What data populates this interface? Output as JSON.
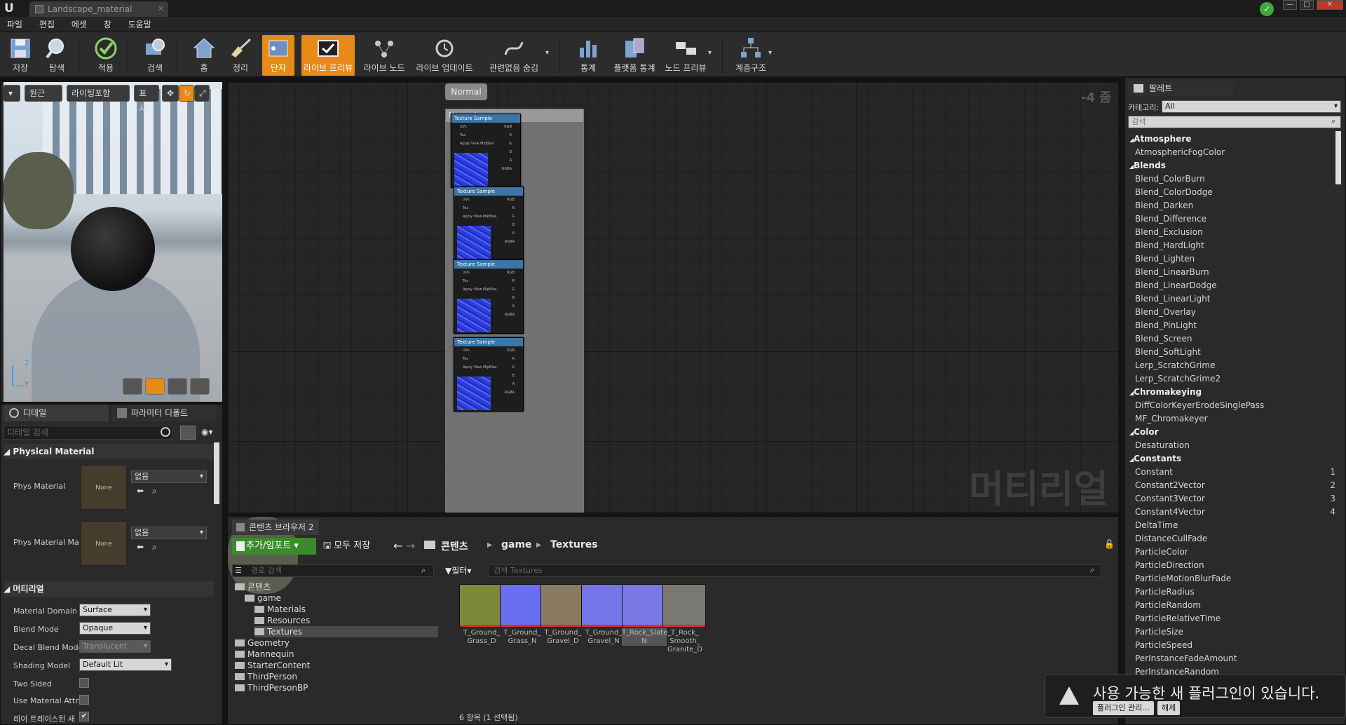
{
  "window": {
    "tab_title": "Landscape_material",
    "minimize_label": "—",
    "maximize_label": "□",
    "close_label": "✕"
  },
  "menu": [
    "파일",
    "편집",
    "에셋",
    "창",
    "도움말"
  ],
  "toolbar": {
    "items": [
      {
        "label": "저장",
        "icon": "save-icon"
      },
      {
        "label": "탐색",
        "icon": "browse-icon"
      },
      {
        "label": "적용",
        "icon": "apply-icon"
      },
      {
        "label": "검색",
        "icon": "search-icon"
      },
      {
        "label": "홈",
        "icon": "home-icon"
      },
      {
        "label": "정리",
        "icon": "clean-up-icon"
      },
      {
        "label": "단자",
        "icon": "connectors-icon",
        "active": true
      },
      {
        "label": "라이브 프리뷰",
        "icon": "live-preview-icon",
        "active": true
      },
      {
        "label": "라이브 노드",
        "icon": "live-nodes-icon"
      },
      {
        "label": "라이브 업데이트",
        "icon": "live-update-icon"
      },
      {
        "label": "관련없음 숨김",
        "icon": "hide-unrelated-icon"
      },
      {
        "label": "통계",
        "icon": "stats-icon"
      },
      {
        "label": "플랫폼 통계",
        "icon": "platform-stats-icon"
      },
      {
        "label": "노드 프리뷰",
        "icon": "node-preview-icon"
      },
      {
        "label": "계층구조",
        "icon": "hierarchy-icon"
      }
    ]
  },
  "viewport": {
    "perspective": "원근",
    "lighting": "라이팅포함",
    "show": "표시",
    "axis_z": "Z",
    "axis_y": "Y"
  },
  "details": {
    "tabs": [
      "디테일",
      "파라미터 디폴트"
    ],
    "search_placeholder": "디테일 검색",
    "physical_section": "Physical Material",
    "phys_rows": [
      {
        "label": "Phys Material",
        "thumb": "None",
        "value": "없음"
      },
      {
        "label": "Phys Material Ma",
        "thumb": "None",
        "value": "없음"
      }
    ],
    "material_section": "머티리얼",
    "props": [
      {
        "label": "Material Domain",
        "value": "Surface"
      },
      {
        "label": "Blend Mode",
        "value": "Opaque"
      },
      {
        "label": "Decal Blend Mode",
        "value": "Translucent"
      },
      {
        "label": "Shading Model",
        "value": "Default Lit"
      },
      {
        "label": "Two Sided",
        "checked": false
      },
      {
        "label": "Use Material Attri",
        "checked": false
      },
      {
        "label": "레이 트레이스된 새",
        "checked": true
      }
    ]
  },
  "graph": {
    "zoom": "-4 줌",
    "watermark": "머티리얼",
    "comment_bubble": "Normal",
    "comment_title": "Normal",
    "node_title": "Texture Sample",
    "pins": [
      {
        "in": "UVs",
        "out": "RGB"
      },
      {
        "in": "Tex",
        "out": "R"
      },
      {
        "in": "Apply View MipBias",
        "out": "G"
      },
      {
        "in": "",
        "out": "B"
      },
      {
        "in": "",
        "out": "A"
      },
      {
        "in": "",
        "out": "RGBA"
      }
    ]
  },
  "content_browser": {
    "tab": "콘텐츠 브라우저 2",
    "add_import": "추가/임포트",
    "save_all": "모두 저장",
    "breadcrumb": [
      "콘텐츠",
      "game",
      "Textures"
    ],
    "path_search_placeholder": "경로 검색",
    "filters_label": "필터",
    "asset_search_placeholder": "검색 Textures",
    "tree": [
      {
        "label": "콘텐츠",
        "level": 0
      },
      {
        "label": "game",
        "level": 1
      },
      {
        "label": "Materials",
        "level": 2
      },
      {
        "label": "Resources",
        "level": 2
      },
      {
        "label": "Textures",
        "level": 2,
        "selected": true
      },
      {
        "label": "Geometry",
        "level": 0
      },
      {
        "label": "Mannequin",
        "level": 0
      },
      {
        "label": "StarterContent",
        "level": 0
      },
      {
        "label": "ThirdPerson",
        "level": 0
      },
      {
        "label": "ThirdPersonBP",
        "level": 0
      }
    ],
    "assets": [
      {
        "name": "T_Ground_ Grass_D",
        "color": "#7a8a3a"
      },
      {
        "name": "T_Ground_ Grass_N",
        "color": "#6a6ef0"
      },
      {
        "name": "T_Ground_ Gravel_D",
        "color": "#8a7a62"
      },
      {
        "name": "T_Ground_ Gravel_N",
        "color": "#7476e8"
      },
      {
        "name": "T_Rock_Slate_ N",
        "color": "#7a7ae6",
        "selected": true
      },
      {
        "name": "T_Rock_ Smooth_ Granite_D",
        "color": "#7a7872"
      }
    ],
    "item_count": "6 항목 (1 선택됨)"
  },
  "palette": {
    "tab": "팔레트",
    "category_label": "카테고리:",
    "category_value": "All",
    "search_placeholder": "검색",
    "items": [
      {
        "label": "Atmosphere",
        "cat": true
      },
      {
        "label": "AtmosphericFogColor"
      },
      {
        "label": "Blends",
        "cat": true
      },
      {
        "label": "Blend_ColorBurn"
      },
      {
        "label": "Blend_ColorDodge"
      },
      {
        "label": "Blend_Darken"
      },
      {
        "label": "Blend_Difference"
      },
      {
        "label": "Blend_Exclusion"
      },
      {
        "label": "Blend_HardLight"
      },
      {
        "label": "Blend_Lighten"
      },
      {
        "label": "Blend_LinearBurn"
      },
      {
        "label": "Blend_LinearDodge"
      },
      {
        "label": "Blend_LinearLight"
      },
      {
        "label": "Blend_Overlay"
      },
      {
        "label": "Blend_PinLight"
      },
      {
        "label": "Blend_Screen"
      },
      {
        "label": "Blend_SoftLight"
      },
      {
        "label": "Lerp_ScratchGrime"
      },
      {
        "label": "Lerp_ScratchGrime2"
      },
      {
        "label": "Chromakeying",
        "cat": true
      },
      {
        "label": "DiffColorKeyerErodeSinglePass"
      },
      {
        "label": "MF_Chromakeyer"
      },
      {
        "label": "Color",
        "cat": true
      },
      {
        "label": "Desaturation"
      },
      {
        "label": "Constants",
        "cat": true
      },
      {
        "label": "Constant",
        "key": "1"
      },
      {
        "label": "Constant2Vector",
        "key": "2"
      },
      {
        "label": "Constant3Vector",
        "key": "3"
      },
      {
        "label": "Constant4Vector",
        "key": "4"
      },
      {
        "label": "DeltaTime"
      },
      {
        "label": "DistanceCullFade"
      },
      {
        "label": "ParticleColor"
      },
      {
        "label": "ParticleDirection"
      },
      {
        "label": "ParticleMotionBlurFade"
      },
      {
        "label": "ParticleRadius"
      },
      {
        "label": "ParticleRandom"
      },
      {
        "label": "ParticleRelativeTime"
      },
      {
        "label": "ParticleSize"
      },
      {
        "label": "ParticleSpeed"
      },
      {
        "label": "PerInstanceFadeAmount"
      },
      {
        "label": "PerInstanceRandom"
      }
    ]
  },
  "notification": {
    "text": "사용 가능한 새 플러그인이 있습니다.",
    "manage": "플러그인 관리...",
    "dismiss": "해제"
  }
}
